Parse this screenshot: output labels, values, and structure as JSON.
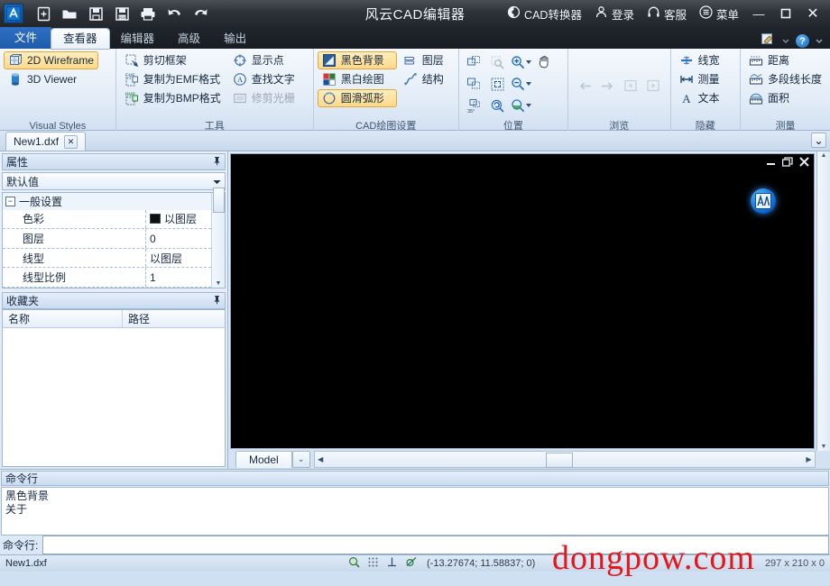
{
  "window": {
    "title": "风云CAD编辑器",
    "logo_icon": "app-logo-icon",
    "quick_access": [
      {
        "name": "new-file-icon",
        "label": "新建"
      },
      {
        "name": "open-folder-icon",
        "label": "打开"
      },
      {
        "name": "save-icon",
        "label": "保存"
      },
      {
        "name": "save-as-pdf-icon",
        "label": "另存为"
      },
      {
        "name": "print-icon",
        "label": "打印"
      },
      {
        "name": "undo-icon",
        "label": "撤销"
      },
      {
        "name": "redo-icon",
        "label": "重做"
      }
    ],
    "right_items": [
      {
        "name": "cad-converter",
        "label": "CAD转换器",
        "icon": "converter-icon"
      },
      {
        "name": "login",
        "label": "登录",
        "icon": "user-icon"
      },
      {
        "name": "support",
        "label": "客服",
        "icon": "headset-icon"
      },
      {
        "name": "menu",
        "label": "菜单",
        "icon": "hamburger-icon"
      }
    ],
    "controls": {
      "minimize": "—",
      "maximize": "❐",
      "close": "✕"
    }
  },
  "ribbon": {
    "tabs": [
      {
        "label": "文件",
        "state": "file"
      },
      {
        "label": "查看器",
        "state": "active"
      },
      {
        "label": "编辑器",
        "state": "normal"
      },
      {
        "label": "高级",
        "state": "normal"
      },
      {
        "label": "输出",
        "state": "normal"
      }
    ],
    "help_label": "?",
    "groups": [
      {
        "title": "Visual Styles",
        "items": [
          {
            "label": "2D Wireframe",
            "icon": "wireframe-cube-icon",
            "selected": true
          },
          {
            "label": "3D Viewer",
            "icon": "3d-cylinder-icon",
            "selected": false
          }
        ]
      },
      {
        "title": "工具",
        "col1": [
          {
            "label": "剪切框架",
            "icon": "crop-frame-icon",
            "disabled": false
          },
          {
            "label": "复制为EMF格式",
            "icon": "copy-emf-icon",
            "disabled": false
          },
          {
            "label": "复制为BMP格式",
            "icon": "copy-bmp-icon",
            "disabled": false
          }
        ],
        "col2": [
          {
            "label": "显示点",
            "icon": "show-point-icon",
            "disabled": false
          },
          {
            "label": "查找文字",
            "icon": "find-text-icon",
            "disabled": false
          },
          {
            "label": "修剪光栅",
            "icon": "trim-raster-icon",
            "disabled": true
          }
        ]
      },
      {
        "title": "CAD绘图设置",
        "col1": [
          {
            "label": "黑色背景",
            "icon": "black-background-icon",
            "selected": true
          },
          {
            "label": "黑白绘图",
            "icon": "bw-drawing-icon",
            "selected": false
          },
          {
            "label": "圆滑弧形",
            "icon": "smooth-arc-icon",
            "selected": true
          }
        ],
        "col2": [
          {
            "label": "图层",
            "icon": "layers-icon",
            "selected": false
          },
          {
            "label": "结构",
            "icon": "structure-icon",
            "selected": false
          }
        ]
      },
      {
        "title": "位置",
        "grid": [
          {
            "name": "zoom-window-icon",
            "disabled": false
          },
          {
            "name": "zoom-selected-icon",
            "disabled": true
          },
          {
            "name": "zoom-in-icon",
            "dropdown": true,
            "disabled": false
          },
          {
            "name": "pan-hand-icon",
            "disabled": false
          },
          {
            "name": "zoom-extents-icon",
            "disabled": false
          },
          {
            "name": "zoom-fit-icon",
            "disabled": false
          },
          {
            "name": "zoom-out-icon",
            "dropdown": true,
            "disabled": false
          },
          {
            "name": "empty-cell",
            "disabled": true
          },
          {
            "name": "rotate-35-icon",
            "disabled": false
          },
          {
            "name": "zoom-previous-icon",
            "disabled": false
          },
          {
            "name": "zoom-realtime-icon",
            "dropdown": true,
            "disabled": false
          },
          {
            "name": "empty-cell-2",
            "disabled": true
          }
        ]
      },
      {
        "title": "浏览",
        "grid": [
          {
            "name": "back-arrow-icon",
            "disabled": true
          },
          {
            "name": "forward-arrow-icon",
            "disabled": true
          },
          {
            "name": "prev-view-icon",
            "disabled": true
          },
          {
            "name": "next-view-icon",
            "disabled": true
          }
        ]
      },
      {
        "title": "隐藏",
        "items": [
          {
            "label": "线宽",
            "icon": "lineweight-icon"
          },
          {
            "label": "测量",
            "icon": "measure-icon"
          },
          {
            "label": "文本",
            "icon": "text-a-icon"
          }
        ]
      },
      {
        "title": "测量",
        "items": [
          {
            "label": "距离",
            "icon": "distance-icon"
          },
          {
            "label": "多段线长度",
            "icon": "polyline-length-icon"
          },
          {
            "label": "面积",
            "icon": "area-icon"
          }
        ]
      }
    ]
  },
  "document_tabs": {
    "tabs": [
      {
        "label": "New1.dxf",
        "close": "✕"
      }
    ],
    "overflow": "⌄"
  },
  "properties_panel": {
    "title": "属性",
    "pin": "📌",
    "selector_value": "默认值",
    "category": "一般设置",
    "collapse_glyph": "−",
    "rows": [
      {
        "key": "色彩",
        "value": "以图层",
        "swatch": "#101010"
      },
      {
        "key": "图层",
        "value": "0",
        "swatch": null
      },
      {
        "key": "线型",
        "value": "以图层",
        "swatch": null
      },
      {
        "key": "线型比例",
        "value": "1",
        "swatch": null
      }
    ]
  },
  "favorites_panel": {
    "title": "收藏夹",
    "pin": "📌",
    "columns": [
      "名称",
      "路径"
    ],
    "rows": []
  },
  "canvas": {
    "background": "#000000",
    "mdi_controls": {
      "minimize": "—",
      "restore": "❐",
      "close": "✕"
    },
    "app_glyph": "app-logo-icon",
    "layout_tabs": [
      {
        "label": "Model",
        "active": true
      }
    ],
    "overflow_button": "⌄"
  },
  "command_panel": {
    "title": "命令行",
    "log_lines": [
      "黑色背景",
      "关于"
    ],
    "input_label": "命令行:",
    "input_value": "",
    "input_placeholder": ""
  },
  "status_bar": {
    "file": "New1.dxf",
    "icons": [
      {
        "name": "osnap-icon"
      },
      {
        "name": "grid-snap-icon"
      },
      {
        "name": "ortho-icon"
      },
      {
        "name": "polar-tracking-icon"
      }
    ],
    "coordinates": "(-13.27674; 11.58837; 0)",
    "size": "297 x 210 x 0"
  },
  "watermark": {
    "text": "dongpow.com",
    "color": "#e8161a"
  },
  "colors": {
    "accent": "#1f5ba9",
    "ribbon_highlight": "#fdd98a",
    "titlebar": "#2d3238",
    "canvas": "#000000",
    "watermark": "#e8161a"
  }
}
